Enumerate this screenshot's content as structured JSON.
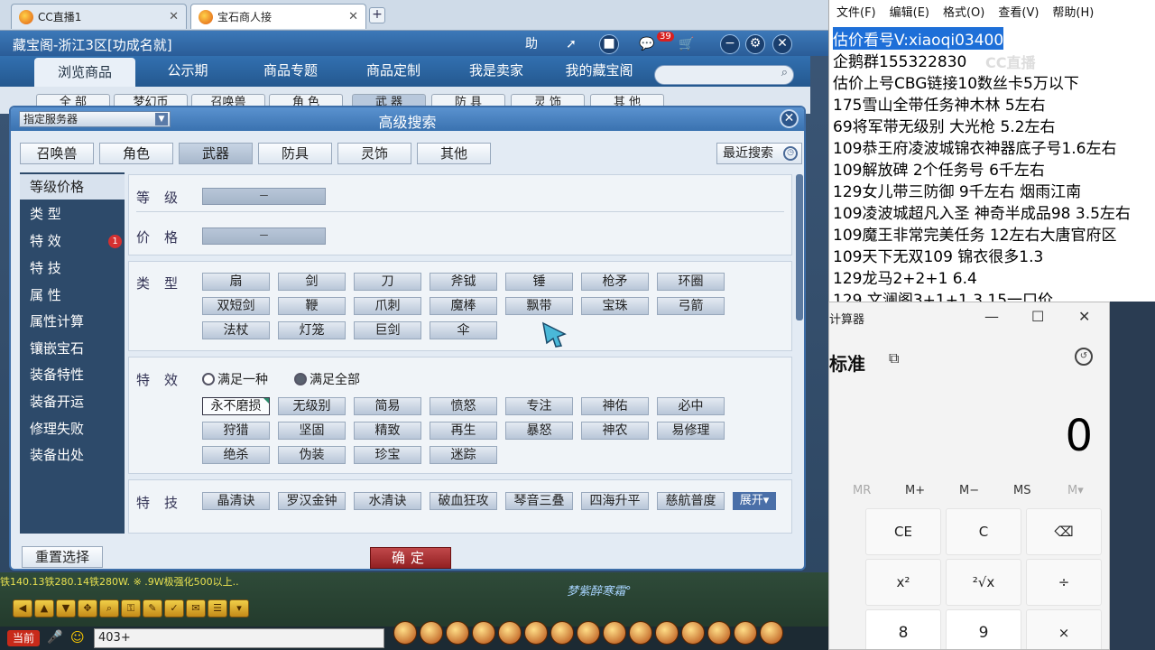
{
  "browser_tabs": [
    {
      "label": "CC直播1"
    },
    {
      "label": "宝石商人接"
    }
  ],
  "game": {
    "title": "藏宝阁-浙江3区[功成名就]",
    "header_icons": {
      "help": "助",
      "mail_badge": "39"
    },
    "nav": [
      "浏览商品",
      "公示期",
      "商品专题",
      "商品定制",
      "我是卖家",
      "我的藏宝阁"
    ],
    "behind_tabs": [
      "全 部",
      "梦幻币",
      "召唤兽",
      "角 色",
      "武 器",
      "防 具",
      "灵 饰",
      "其 他"
    ],
    "scroll_text": "铁140.13铁280.14铁280W.  ※ .9W极强化500以上..",
    "watermark": "梦紫醉寒霜°",
    "chat_channel": "当前",
    "chat_input": "403+"
  },
  "dialog": {
    "title": "高级搜索",
    "server_select": "指定服务器",
    "categories": [
      "召唤兽",
      "角色",
      "武器",
      "防具",
      "灵饰",
      "其他"
    ],
    "recent_search": "最近搜索",
    "side_menu": [
      "等级价格",
      "类 型",
      "特 效",
      "特 技",
      "属 性",
      "属性计算",
      "镶嵌宝石",
      "装备特性",
      "装备开运",
      "修理失败",
      "装备出处"
    ],
    "side_badge": "1",
    "level_label": "等级",
    "level_value": "－",
    "price_label": "价格",
    "price_value": "－",
    "type_label": "类型",
    "types": [
      "扇",
      "剑",
      "刀",
      "斧钺",
      "锤",
      "枪矛",
      "环圈",
      "双短剑",
      "鞭",
      "爪刺",
      "魔棒",
      "飘带",
      "宝珠",
      "弓箭",
      "法杖",
      "灯笼",
      "巨剑",
      "伞"
    ],
    "effect_label": "特效",
    "effect_radio": [
      "满足一种",
      "满足全部"
    ],
    "effects": [
      "永不磨损",
      "无级别",
      "简易",
      "愤怒",
      "专注",
      "神佑",
      "必中",
      "狩猎",
      "坚固",
      "精致",
      "再生",
      "暴怒",
      "神农",
      "易修理",
      "绝杀",
      "伪装",
      "珍宝",
      "迷踪"
    ],
    "skill_label": "特技",
    "skills": [
      "晶清诀",
      "罗汉金钟",
      "水清诀",
      "破血狂攻",
      "琴音三叠",
      "四海升平",
      "慈航普度"
    ],
    "expand": "展开▾",
    "reset": "重置选择",
    "confirm": "确定"
  },
  "notepad": {
    "menu": [
      "文件(F)",
      "编辑(E)",
      "格式(O)",
      "查看(V)",
      "帮助(H)"
    ],
    "lines": [
      "估价看号V:xiaoqi03400",
      "企鹅群155322830",
      "估价上号CBG链接10数丝卡5万以下",
      "175雪山全带任务神木林 5左右",
      "69将军带无级别 大光枪 5.2左右",
      "109恭王府凌波城锦衣神器底子号1.6左右",
      "109解放碑 2个任务号 6千左右",
      "129女儿带三防御 9千左右 烟雨江南",
      "109凌波城超凡入圣 神奇半成品98 3.5左右",
      "109魔王非常完美任务 12左右大唐官府区",
      "109天下无双109  锦衣很多1.3",
      "129龙马2+2+1  6.4",
      "129 文澜阁3+1+1   3.15一口价"
    ],
    "watermark": "CC直播"
  },
  "calculator": {
    "title": "计算器",
    "mode": "标准",
    "display": "0",
    "memory": [
      "MR",
      "M+",
      "M−",
      "MS",
      "M▾"
    ],
    "keys_row1": [
      "CE",
      "C",
      "⌫"
    ],
    "keys_row2": [
      "x²",
      "²√x",
      "÷"
    ],
    "keys_row3": [
      "8",
      "9",
      "×"
    ]
  }
}
